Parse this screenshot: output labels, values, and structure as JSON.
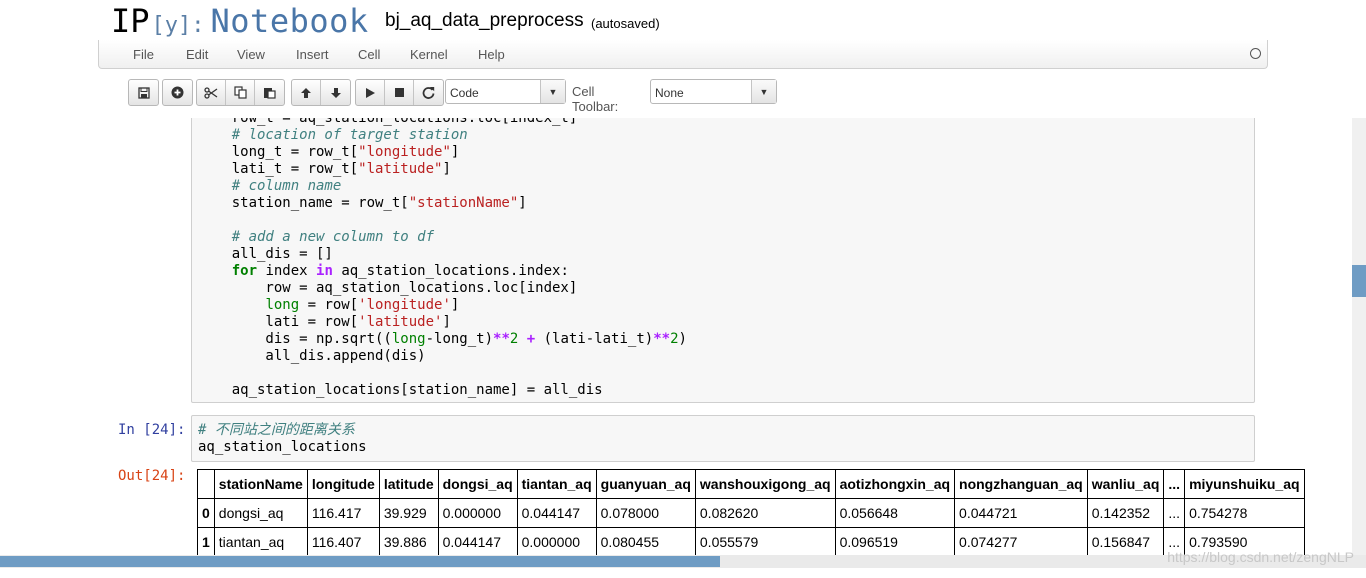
{
  "header": {
    "logo_ip": "IP",
    "logo_y": "[y]:",
    "logo_notebook": "Notebook",
    "notebook_name": "bj_aq_data_preprocess",
    "autosave": "(autosaved)"
  },
  "menu": [
    "File",
    "Edit",
    "View",
    "Insert",
    "Cell",
    "Kernel",
    "Help"
  ],
  "toolbar": {
    "cell_type": "Code",
    "cell_toolbar_label": "Cell Toolbar:",
    "cell_toolbar_value": "None",
    "icons": [
      "save-icon",
      "add-cell-icon",
      "cut-icon",
      "copy-icon",
      "paste-icon",
      "move-up-icon",
      "move-down-icon",
      "run-icon",
      "stop-icon",
      "restart-icon"
    ]
  },
  "cells": {
    "prev_code": [
      "    row_t = aq_station_locations.loc[index_t]",
      "    # location of target station",
      "    long_t = row_t[\"longitude\"]",
      "    lati_t = row_t[\"latitude\"]",
      "    # column name",
      "    station_name = row_t[\"stationName\"]",
      "",
      "    # add a new column to df",
      "    all_dis = []",
      "    for index in aq_station_locations.index:",
      "        row = aq_station_locations.loc[index]",
      "        long = row['longitude']",
      "        lati = row['latitude']",
      "        dis = np.sqrt((long-long_t)**2 + (lati-lati_t)**2)",
      "        all_dis.append(dis)",
      "",
      "    aq_station_locations[station_name] = all_dis"
    ],
    "in_prompt": "In [24]:",
    "in_comment": "# 不同站之间的距离关系",
    "in_code": "aq_station_locations",
    "out_prompt": "Out[24]:"
  },
  "table": {
    "columns": [
      "",
      "stationName",
      "longitude",
      "latitude",
      "dongsi_aq",
      "tiantan_aq",
      "guanyuan_aq",
      "wanshouxigong_aq",
      "aotizhongxin_aq",
      "nongzhanguan_aq",
      "wanliu_aq",
      "...",
      "miyunshuiku_aq"
    ],
    "rows": [
      [
        "0",
        "dongsi_aq",
        "116.417",
        "39.929",
        "0.000000",
        "0.044147",
        "0.078000",
        "0.082620",
        "0.056648",
        "0.044721",
        "0.142352",
        "...",
        "0.754278"
      ],
      [
        "1",
        "tiantan_aq",
        "116.407",
        "39.886",
        "0.044147",
        "0.000000",
        "0.080455",
        "0.055579",
        "0.096519",
        "0.074277",
        "0.156847",
        "...",
        "0.793590"
      ]
    ]
  },
  "watermark": "https://blog.csdn.net/zengNLP"
}
